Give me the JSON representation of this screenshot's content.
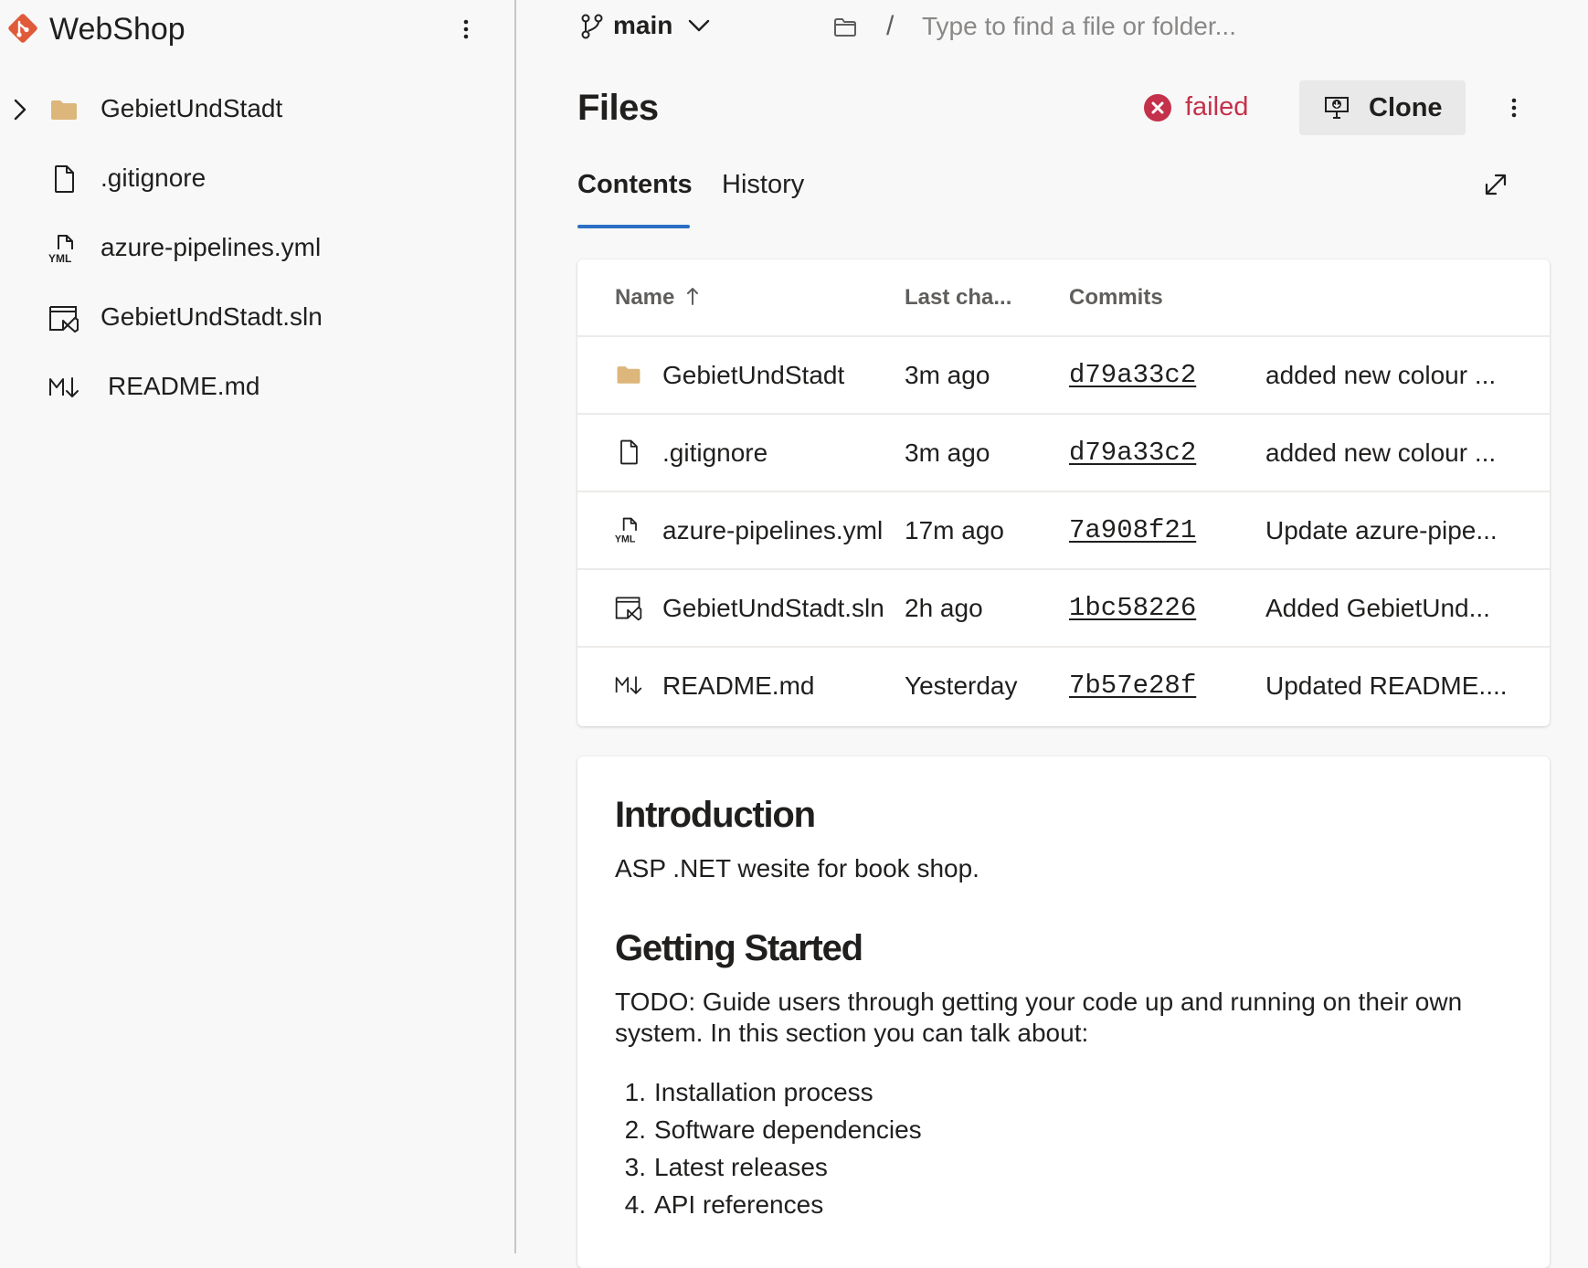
{
  "sidebar": {
    "repo_name": "WebShop",
    "items": [
      {
        "label": "GebietUndStadt",
        "icon": "folder-icon",
        "expandable": true
      },
      {
        "label": ".gitignore",
        "icon": "file-icon"
      },
      {
        "label": "azure-pipelines.yml",
        "icon": "yml-file-icon"
      },
      {
        "label": "GebietUndStadt.sln",
        "icon": "visual-studio-solution-icon"
      },
      {
        "label": "README.md",
        "icon": "markdown-icon"
      }
    ]
  },
  "branch": {
    "name": "main"
  },
  "path_search": {
    "separator": "/",
    "placeholder": "Type to find a file or folder..."
  },
  "header": {
    "title": "Files",
    "status": "failed",
    "clone_label": "Clone"
  },
  "tabs": [
    {
      "label": "Contents",
      "active": true
    },
    {
      "label": "History",
      "active": false
    }
  ],
  "table": {
    "columns": {
      "name": "Name",
      "last_change": "Last cha...",
      "commits": "Commits"
    },
    "rows": [
      {
        "name": "GebietUndStadt",
        "icon": "folder-icon",
        "date": "3m ago",
        "hash": "d79a33c2",
        "message": "added new colour ..."
      },
      {
        "name": ".gitignore",
        "icon": "file-icon",
        "date": "3m ago",
        "hash": "d79a33c2",
        "message": "added new colour ..."
      },
      {
        "name": "azure-pipelines.yml",
        "icon": "yml-file-icon",
        "date": "17m ago",
        "hash": "7a908f21",
        "message": "Update azure-pipe..."
      },
      {
        "name": "GebietUndStadt.sln",
        "icon": "visual-studio-solution-icon",
        "date": "2h ago",
        "hash": "1bc58226",
        "message": "Added GebietUnd..."
      },
      {
        "name": "README.md",
        "icon": "markdown-icon",
        "date": "Yesterday",
        "hash": "7b57e28f",
        "message": "Updated README...."
      }
    ]
  },
  "readme": {
    "h1_intro": "Introduction",
    "p_intro": "ASP .NET wesite for book shop.",
    "h1_start": "Getting Started",
    "p_start": "TODO: Guide users through getting your code up and running on their own system. In this section you can talk about:",
    "list": [
      {
        "num": "1.",
        "text": "Installation process"
      },
      {
        "num": "2.",
        "text": "Software dependencies"
      },
      {
        "num": "3.",
        "text": "Latest releases"
      },
      {
        "num": "4.",
        "text": "API references"
      }
    ]
  },
  "colors": {
    "accent": "#2b6fc5",
    "error": "#c4314b",
    "repo_logo": "#e05a3a",
    "folder": "#dcb67a"
  }
}
